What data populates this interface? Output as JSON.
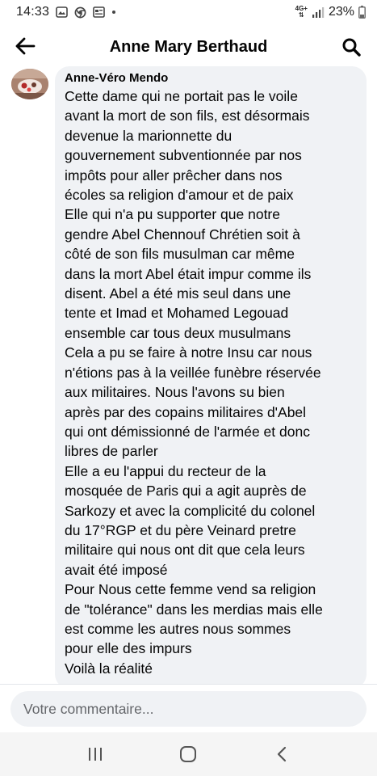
{
  "status_bar": {
    "time": "14:33",
    "network_label_top": "4G+",
    "network_label_bottom": "⇅",
    "battery": "23%"
  },
  "header": {
    "title": "Anne Mary Berthaud"
  },
  "comment": {
    "author": "Anne-Véro Mendo",
    "lines": [
      "Cette dame qui ne portait pas le voile",
      "avant la mort de son fils, est désormais",
      "devenue la marionnette du",
      "gouvernement subventionnée par nos",
      "impôts pour aller prêcher dans nos",
      "écoles sa religion d'amour et de paix",
      "Elle qui n'a pu supporter que notre",
      "gendre Abel Chennouf Chrétien soit à",
      "côté de son fils musulman car même",
      "dans la mort Abel était impur comme ils",
      "disent. Abel a été mis seul dans une",
      "tente et Imad et Mohamed Legouad",
      "ensemble car tous deux musulmans",
      "Cela a pu se faire à  notre Insu car nous",
      "n'étions pas à la veillée funèbre réservée",
      "aux militaires. Nous l'avons  su bien",
      "après par des copains militaires d'Abel",
      "qui ont démissionné de l'armée et donc",
      "libres de parler",
      "Elle a eu  l'appui du recteur de la",
      "mosquée de Paris qui a agit auprès de",
      "Sarkozy et avec la complicité du colonel",
      "du 17°RGP et du père Veinard pretre",
      "militaire qui nous ont dit que cela leurs",
      "avait été imposé",
      "Pour Nous cette femme vend sa religion",
      "de \"tolérance\" dans les merdias mais elle",
      "est comme les autres nous sommes",
      "pour elle des impurs",
      "Voilà  la réalité"
    ]
  },
  "composer": {
    "placeholder": "Votre commentaire..."
  },
  "icons": {
    "back": "arrow-left-icon",
    "search": "search-icon",
    "nav_recent": "recent-apps-icon",
    "nav_home": "home-icon",
    "nav_back": "chevron-left-icon"
  }
}
